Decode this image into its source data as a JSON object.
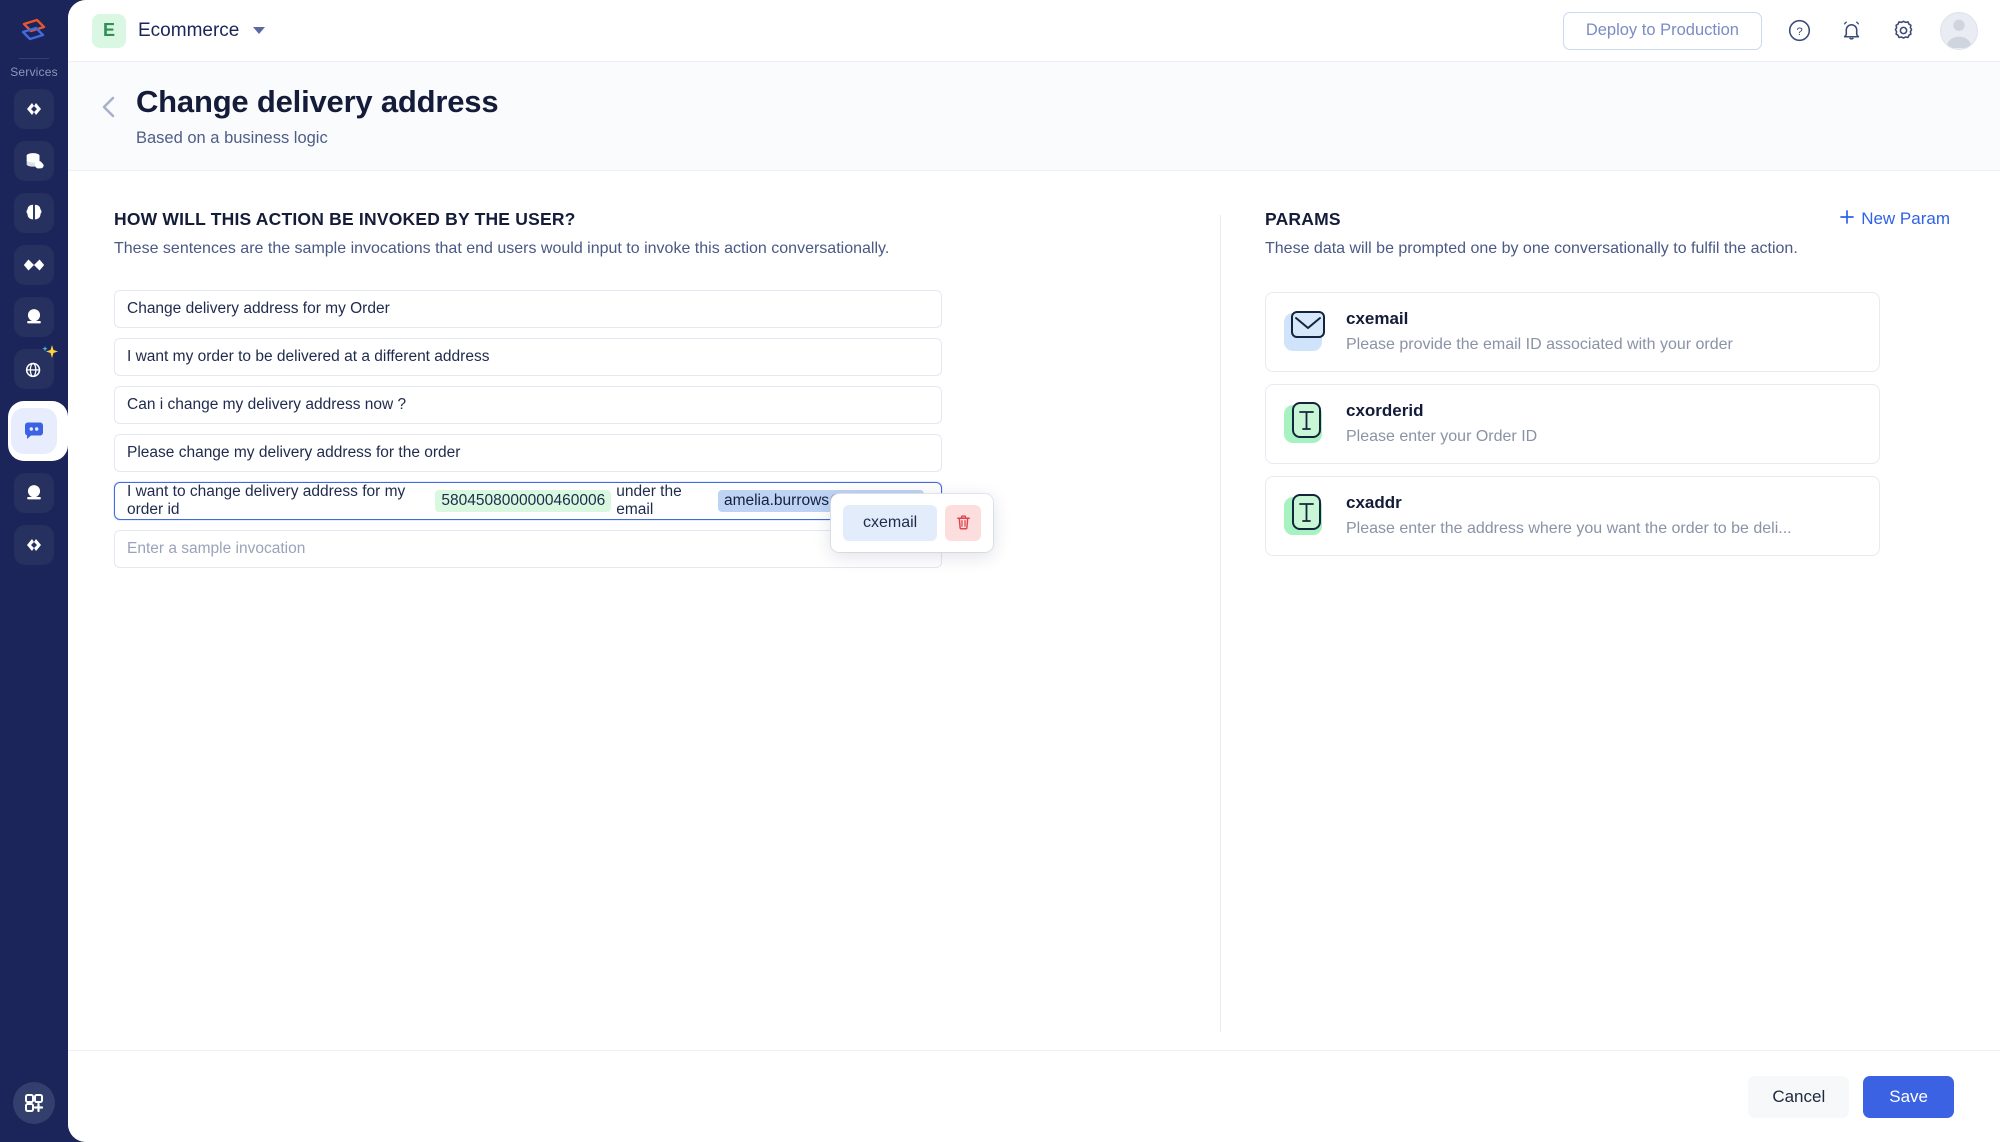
{
  "rail": {
    "logo_icon": "zoho-logo-icon",
    "section_label": "Services",
    "items": [
      {
        "icon": "code-brackets-icon",
        "name": "service-code"
      },
      {
        "icon": "database-cloud-icon",
        "name": "service-datastore"
      },
      {
        "icon": "brain-icon",
        "name": "service-ai"
      },
      {
        "icon": "infinity-icon",
        "name": "service-flow"
      },
      {
        "icon": "crystal-ball-icon",
        "name": "service-predict"
      },
      {
        "icon": "globe-sparkle-icon",
        "name": "service-web-ai"
      },
      {
        "icon": "chat-bubble-icon",
        "name": "service-conversations",
        "active": true
      },
      {
        "icon": "crystal-ball-icon",
        "name": "service-insights"
      },
      {
        "icon": "code-brackets-icon",
        "name": "service-functions"
      }
    ],
    "bottom_icon": "apps-grid-plus-icon"
  },
  "topbar": {
    "project_initial": "E",
    "project_name": "Ecommerce",
    "deploy_label": "Deploy to Production",
    "help_icon": "help-circle-icon",
    "bell_icon": "notification-bell-icon",
    "gear_icon": "settings-gear-icon",
    "avatar_icon": "user-avatar"
  },
  "page": {
    "back_icon": "chevron-left-icon",
    "title": "Change delivery address",
    "subtitle": "Based on a business logic"
  },
  "invocations": {
    "section_title": "HOW WILL THIS ACTION BE INVOKED BY THE USER?",
    "section_desc": "These sentences are the sample invocations that end users would input to invoke this action conversationally.",
    "rows": [
      {
        "text": "Change delivery address for my Order"
      },
      {
        "text": "I want my order to be delivered at a different address"
      },
      {
        "text": "Can i change my delivery address now ?"
      },
      {
        "text": "Please change my delivery address for the order"
      }
    ],
    "active_row": {
      "prefix": "I want to change delivery address for my order id",
      "entity_order_id": "5804508000000460006",
      "middle": "under the email",
      "entity_email": "amelia.burrows@zylker.com"
    },
    "new_row_placeholder": "Enter a sample invocation"
  },
  "entity_popup": {
    "param_label": "cxemail",
    "delete_icon": "trash-icon"
  },
  "params": {
    "section_title": "PARAMS",
    "section_desc": "These data will be prompted one by one conversationally to fulfil the action.",
    "new_param_label": "New Param",
    "new_param_icon": "plus-icon",
    "cards": [
      {
        "name": "cxemail",
        "desc": "Please provide the email ID associated with your order",
        "icon": "envelope-icon",
        "icon_color": "#cfe3fb"
      },
      {
        "name": "cxorderid",
        "desc": "Please enter your Order ID",
        "icon": "text-type-icon",
        "icon_color": "#a6f2c0"
      },
      {
        "name": "cxaddr",
        "desc": "Please enter the address where you want the order to be deli...",
        "icon": "text-type-icon",
        "icon_color": "#a6f2c0"
      }
    ]
  },
  "footer": {
    "cancel_label": "Cancel",
    "save_label": "Save"
  },
  "colors": {
    "rail_bg": "#1b2559",
    "accent_blue": "#3b62e3",
    "link_blue": "#2f62e6",
    "entity_green": "#d9f8e0",
    "entity_blue": "#bfd4f5"
  }
}
